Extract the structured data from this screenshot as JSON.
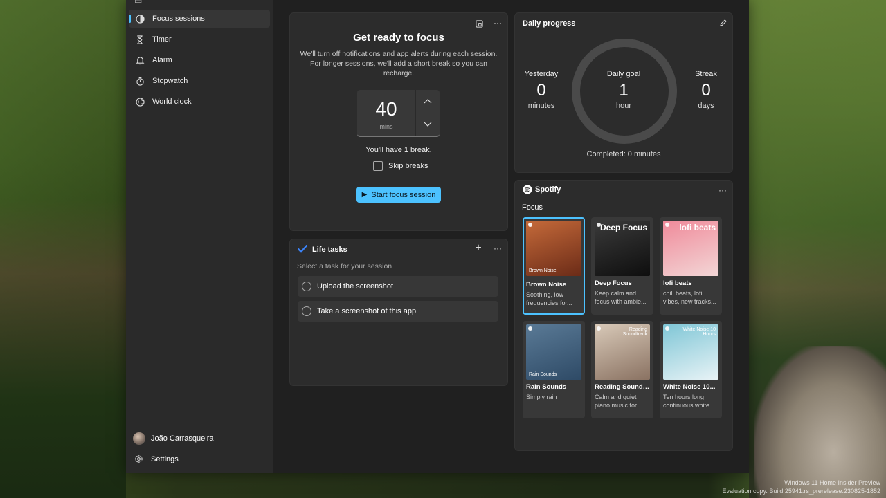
{
  "nav": {
    "items": [
      {
        "label": "Focus sessions",
        "icon": "focus-icon",
        "active": true
      },
      {
        "label": "Timer",
        "icon": "hourglass-icon"
      },
      {
        "label": "Alarm",
        "icon": "bell-icon"
      },
      {
        "label": "Stopwatch",
        "icon": "stopwatch-icon"
      },
      {
        "label": "World clock",
        "icon": "globe-icon"
      }
    ],
    "user_name": "João Carrasqueira",
    "settings_label": "Settings"
  },
  "focus": {
    "heading": "Get ready to focus",
    "description": "We'll turn off notifications and app alerts during each session. For longer sessions, we'll add a short break so you can recharge.",
    "minutes": "40",
    "unit": "mins",
    "break_text": "You'll have 1 break.",
    "skip_breaks_label": "Skip breaks",
    "start_label": "Start focus session"
  },
  "tasks": {
    "title": "Life tasks",
    "hint": "Select a task for your session",
    "items": [
      "Upload the screenshot",
      "Take a screenshot of this app"
    ]
  },
  "progress": {
    "title": "Daily progress",
    "yesterday": {
      "label": "Yesterday",
      "value": "0",
      "unit": "minutes"
    },
    "goal": {
      "label": "Daily goal",
      "value": "1",
      "unit": "hour"
    },
    "streak": {
      "label": "Streak",
      "value": "0",
      "unit": "days"
    },
    "completed": "Completed: 0 minutes"
  },
  "spotify": {
    "brand": "Spotify",
    "section": "Focus",
    "tiles": [
      {
        "title": "Brown Noise",
        "desc": "Soothing, low frequencies for...",
        "art_text": "Brown Noise",
        "colors": [
          "#c56a3a",
          "#6b2b17"
        ]
      },
      {
        "title": "Deep Focus",
        "desc": "Keep calm and focus with ambie...",
        "art_text": "Deep Focus",
        "colors": [
          "#3a3a3a",
          "#0e0e0e"
        ]
      },
      {
        "title": "lofi beats",
        "desc": "chill beats, lofi vibes, new tracks...",
        "art_text": "lofi beats",
        "colors": [
          "#f08a9a",
          "#f2d6d6"
        ]
      },
      {
        "title": "Rain Sounds",
        "desc": "Simply rain",
        "art_text": "Rain Sounds",
        "colors": [
          "#5a7a96",
          "#2e4a66"
        ]
      },
      {
        "title": "Reading Soundtr...",
        "desc": "Calm and quiet piano music for...",
        "art_text": "Reading Soundtrack",
        "colors": [
          "#d8c9b8",
          "#8a7262"
        ]
      },
      {
        "title": "White Noise 10...",
        "desc": "Ten hours long continuous white...",
        "art_text": "White Noise 10 Hours",
        "colors": [
          "#7fc6d6",
          "#e8f3f6"
        ]
      }
    ]
  },
  "desktop": {
    "watermark_line1": "Windows 11 Home Insider Preview",
    "watermark_line2": "Evaluation copy. Build 25941.rs_prerelease.230825-1852"
  },
  "colors": {
    "accent": "#4cc2ff",
    "window": "#202020",
    "card": "#2c2c2c"
  }
}
